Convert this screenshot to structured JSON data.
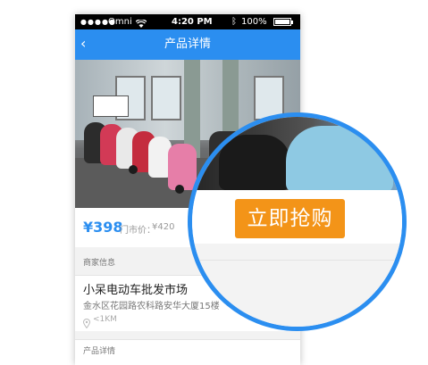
{
  "statusbar": {
    "carrier": "Omni",
    "time": "4:20 PM",
    "battery": "100%"
  },
  "navbar": {
    "back_glyph": "‹",
    "title": "产品详情"
  },
  "product": {
    "price": "¥398",
    "market_price_label": "门市价：",
    "market_price": "¥420"
  },
  "merchant": {
    "section_title": "商家信息",
    "name": "小呆电动车批发市场",
    "address": "金水区花园路农科路安华大厦15楼",
    "distance": "<1KM"
  },
  "details": {
    "section_title": "产品详情"
  },
  "action": {
    "buy_label": "立即抢购"
  },
  "colors": {
    "accent": "#2b8ef0",
    "buy": "#f39418"
  },
  "icons": {
    "back": "chevron-left-icon",
    "wifi": "wifi-icon",
    "bluetooth": "bluetooth-icon",
    "battery": "battery-icon",
    "location": "map-pin-icon"
  }
}
